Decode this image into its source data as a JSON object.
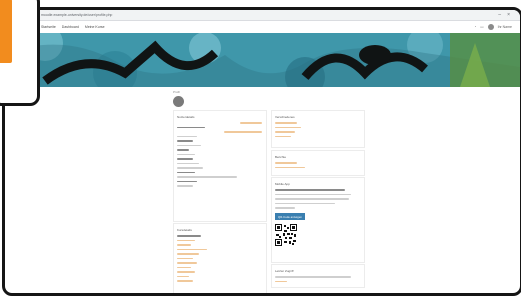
{
  "browser": {
    "url": "moodle.example-university.de/user/profile.php"
  },
  "nav": {
    "links": [
      "Startseite",
      "Dashboard",
      "Meine Kurse"
    ],
    "user_name": "Ihr Name"
  },
  "breadcrumb": "Profil",
  "cards": {
    "user_details": {
      "title": "Nutzerdetails"
    },
    "course_details": {
      "title": "Kursdetails"
    },
    "miscellaneous": {
      "title": "Verschiedenes"
    },
    "reports": {
      "title": "Berichte"
    },
    "mobile_app": {
      "title": "Mobile App",
      "button_label": "QR-Code anzeigen"
    },
    "last_access": {
      "title": "Letzter Zugriff"
    }
  },
  "colors": {
    "accent": "#f28c1e",
    "link": "#f0c89a",
    "button": "#3a7fb0",
    "hero": "#3f97aa"
  },
  "icons": [
    "minimize-icon",
    "close-icon",
    "bell-icon",
    "chat-icon",
    "avatar"
  ]
}
